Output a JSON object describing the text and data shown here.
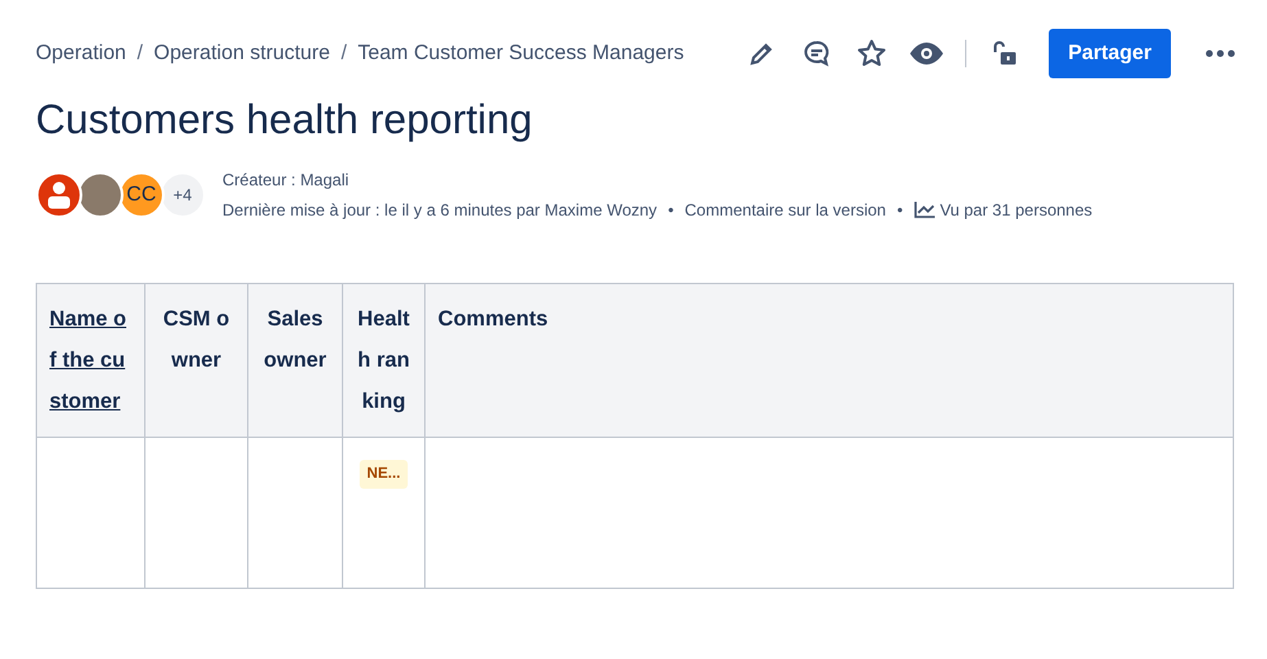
{
  "breadcrumbs": [
    "Operation",
    "Operation structure",
    "Team Customer Success Managers"
  ],
  "breadcrumb_separators": [
    "/",
    "/"
  ],
  "byline_separators": [
    "•",
    "•"
  ],
  "toolbar": {
    "share_button": "Partager"
  },
  "page_title": "Customers health reporting",
  "contributors": [
    {
      "kind": "icon",
      "color": "#de350b"
    },
    {
      "kind": "photo",
      "color": "#8a7a6a"
    },
    {
      "kind": "initials",
      "label": "CC",
      "color": "#ff991f"
    },
    {
      "kind": "count",
      "label": "+4",
      "color": "#f1f2f4"
    }
  ],
  "byline": {
    "creator": "Créateur : Magali",
    "last_update": "Dernière mise à jour : le il y a 6 minutes par Maxime Wozny",
    "comment_link": "Commentaire sur la version",
    "views": "Vu par 31 personnes"
  },
  "table": {
    "columns": [
      {
        "label": "Name of the customer",
        "link": true
      },
      {
        "label": "CSM owner",
        "link": false
      },
      {
        "label": "Sales owner",
        "link": false
      },
      {
        "label": "Health ranking",
        "link": false
      },
      {
        "label": "Comments",
        "link": false
      }
    ],
    "rows": [
      [
        "",
        "",
        "",
        {
          "status": "NE..."
        },
        ""
      ]
    ]
  }
}
